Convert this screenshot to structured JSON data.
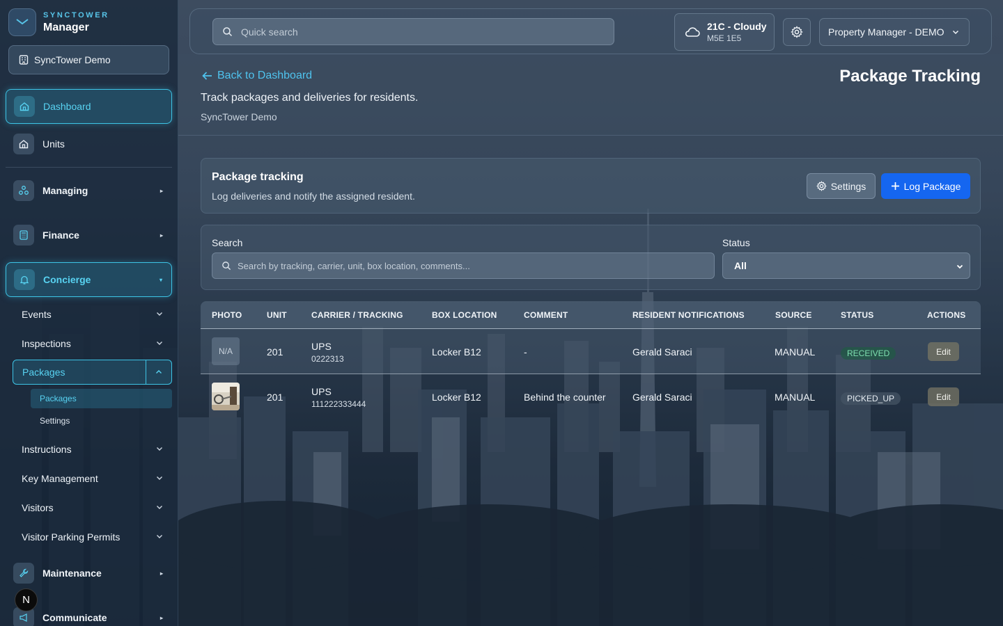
{
  "brand": {
    "kicker": "SYNCTOWER",
    "title": "Manager"
  },
  "org_button": {
    "label": "SyncTower Demo"
  },
  "sidebar": {
    "dashboard": "Dashboard",
    "units": "Units",
    "managing": "Managing",
    "finance": "Finance",
    "concierge": "Concierge",
    "concierge_items": [
      "Events",
      "Inspections",
      "Packages",
      "Instructions",
      "Key Management",
      "Visitors",
      "Visitor Parking Permits"
    ],
    "packages_sub": [
      "Packages",
      "Settings"
    ],
    "maintenance": "Maintenance",
    "communicate": "Communicate",
    "caret": "▸",
    "caret_open": "▾",
    "badge": "N"
  },
  "topbar": {
    "search_placeholder": "Quick search",
    "weather_main": "21C - Cloudy",
    "weather_sub": "M5E 1E5",
    "role": "Property Manager - DEMO"
  },
  "header": {
    "back": "Back to Dashboard",
    "title": "Package Tracking",
    "description": "Track packages and deliveries for residents.",
    "org": "SyncTower Demo"
  },
  "card": {
    "title": "Package tracking",
    "subtitle": "Log deliveries and notify the assigned resident.",
    "settings_btn": "Settings",
    "log_btn": "Log Package"
  },
  "filters": {
    "search_label": "Search",
    "search_placeholder": "Search by tracking, carrier, unit, box location, comments...",
    "status_label": "Status",
    "status_value": "All"
  },
  "table": {
    "columns": [
      "PHOTO",
      "UNIT",
      "CARRIER / TRACKING",
      "BOX LOCATION",
      "COMMENT",
      "RESIDENT NOTIFICATIONS",
      "SOURCE",
      "STATUS",
      "ACTIONS"
    ],
    "rows": [
      {
        "photo": "N/A",
        "unit": "201",
        "carrier": "UPS",
        "tracking": "0222313",
        "box": "Locker B12",
        "comment": "-",
        "resident": "Gerald Saraci",
        "source": "MANUAL",
        "status": "RECEIVED",
        "action": "Edit"
      },
      {
        "photo": "",
        "unit": "201",
        "carrier": "UPS",
        "tracking": "111222333444",
        "box": "Locker B12",
        "comment": "Behind the counter",
        "resident": "Gerald Saraci",
        "source": "MANUAL",
        "status": "PICKED_UP",
        "action": "Edit"
      }
    ]
  },
  "colors": {
    "accent": "#3dc4e6",
    "primary_button": "#1566f0",
    "link": "#4fc3ee"
  }
}
